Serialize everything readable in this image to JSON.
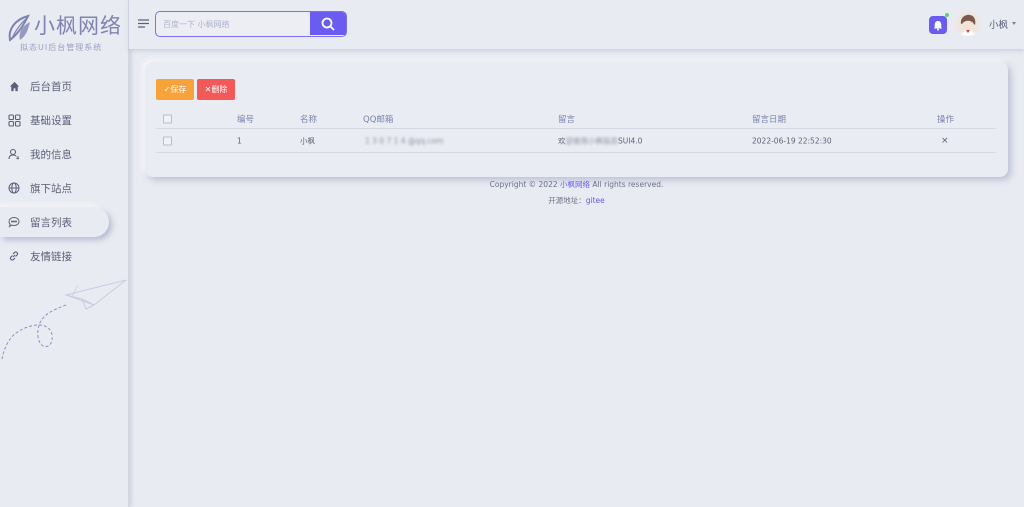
{
  "brand": {
    "title": "小枫网络",
    "subtitle": "拟态UI后台管理系统"
  },
  "sidebar": {
    "items": [
      {
        "label": "后台首页",
        "icon": "home-icon"
      },
      {
        "label": "基础设置",
        "icon": "grid-icon"
      },
      {
        "label": "我的信息",
        "icon": "user-icon"
      },
      {
        "label": "旗下站点",
        "icon": "globe-icon"
      },
      {
        "label": "留言列表",
        "icon": "chat-icon",
        "active": true
      },
      {
        "label": "友情链接",
        "icon": "link-icon"
      }
    ]
  },
  "header": {
    "search_placeholder": "百度一下 小枫网络",
    "username": "小枫"
  },
  "toolbar": {
    "save_label": "✓保存",
    "delete_label": "✕删除"
  },
  "table": {
    "columns": [
      "编号",
      "名称",
      "QQ邮箱",
      "留言",
      "留言日期",
      "操作"
    ],
    "rows": [
      {
        "id": "1",
        "name": "小枫",
        "email": "1 3 0 7 1 4 @qq.com",
        "message_prefix": "欢",
        "message_blur": "迎使用小枫拟态",
        "message_suffix": "SUI4.0",
        "date": "2022-06-19 22:52:30",
        "action": "×"
      }
    ]
  },
  "footer": {
    "copyright_prefix": "Copyright © 2022",
    "copyright_link": "小枫网络",
    "copyright_suffix": "All rights reserved.",
    "source_label": "开源地址：",
    "source_link": "gitee"
  },
  "colors": {
    "accent": "#6a5cf0",
    "save": "#f7a23b",
    "delete": "#f25a5a",
    "background": "#e9ebf2"
  }
}
